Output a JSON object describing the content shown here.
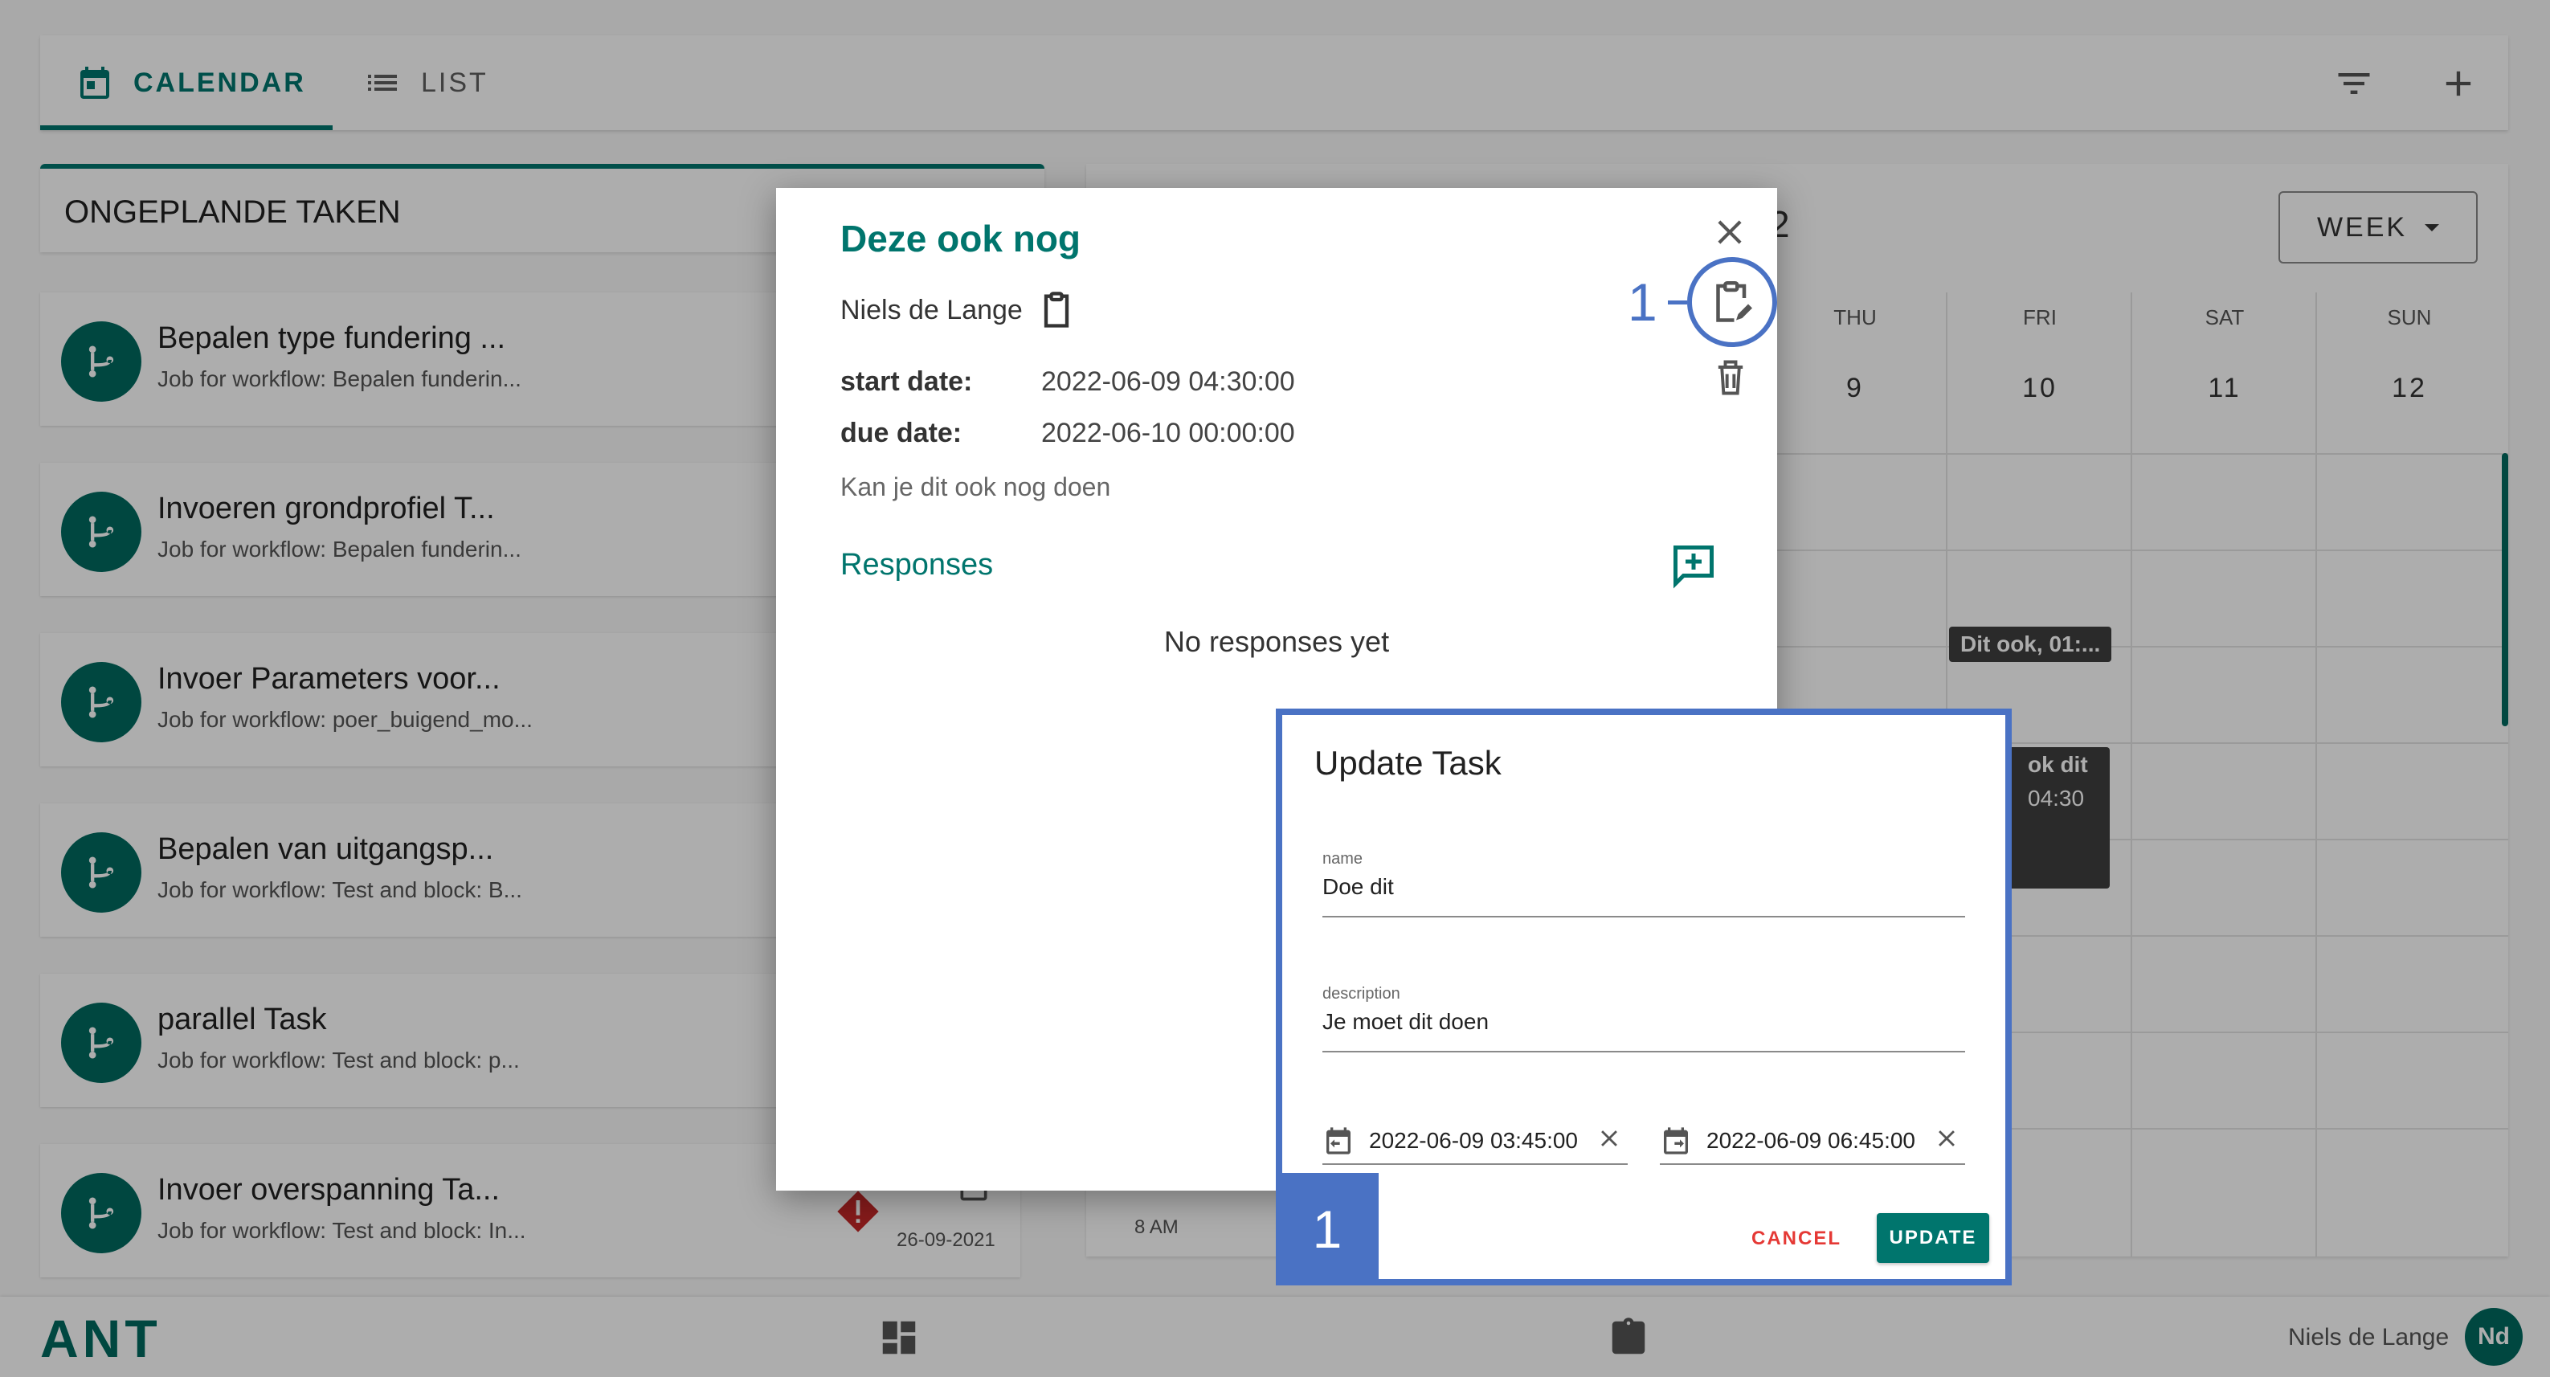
{
  "topbar": {
    "tabs": [
      {
        "label": "CALENDAR",
        "icon": "calendar-icon",
        "active": true
      },
      {
        "label": "LIST",
        "icon": "list-icon",
        "active": false
      }
    ],
    "actions": [
      "filter-icon",
      "add-icon"
    ]
  },
  "unplanned": {
    "header": "ONGEPLANDE TAKEN",
    "tasks": [
      {
        "title": "Bepalen type fundering ...",
        "subtitle": "Job for workflow: Bepalen funderin..."
      },
      {
        "title": "Invoeren grondprofiel T...",
        "subtitle": "Job for workflow: Bepalen funderin..."
      },
      {
        "title": "Invoer Parameters voor...",
        "subtitle": "Job for workflow: poer_buigend_mo..."
      },
      {
        "title": "Bepalen van uitgangsp...",
        "subtitle": "Job for workflow: Test and block: B..."
      },
      {
        "title": "parallel Task",
        "subtitle": "Job for workflow: Test and block: p..."
      },
      {
        "title": "Invoer overspanning Ta...",
        "subtitle": "Job for workflow: Test and block: In...",
        "date": "26-09-2021"
      }
    ]
  },
  "calendar": {
    "view_label": "WEEK",
    "header_partial": "2",
    "days": [
      {
        "name": "THU",
        "num": "9"
      },
      {
        "name": "FRI",
        "num": "10"
      },
      {
        "name": "SAT",
        "num": "11"
      },
      {
        "name": "SUN",
        "num": "12"
      }
    ],
    "events": [
      {
        "label": "Dit ook, 01:..."
      },
      {
        "line1": "ok dit",
        "line2": "04:30"
      }
    ],
    "time_label": "8 AM"
  },
  "bottombar": {
    "logo": "ANT",
    "user_name": "Niels de Lange",
    "user_initials": "Nd"
  },
  "task_dialog": {
    "title": "Deze ook nog",
    "owner": "Niels de Lange",
    "start_label": "start date:",
    "start_value": "2022-06-09 04:30:00",
    "due_label": "due date:",
    "due_value": "2022-06-10 00:00:00",
    "description": "Kan je dit ook nog doen",
    "responses_label": "Responses",
    "no_responses": "No responses yet",
    "callout_number": "1"
  },
  "update_task": {
    "title": "Update Task",
    "name_label": "name",
    "name_value": "Doe dit",
    "description_label": "description",
    "description_value": "Je moet dit doen",
    "start_value": "2022-06-09 03:45:00",
    "end_value": "2022-06-09 06:45:00",
    "step_number": "1",
    "cancel_label": "CANCEL",
    "update_label": "UPDATE"
  },
  "colors": {
    "accent": "#00756d",
    "callout": "#4a72c4",
    "cancel": "#e53935"
  }
}
